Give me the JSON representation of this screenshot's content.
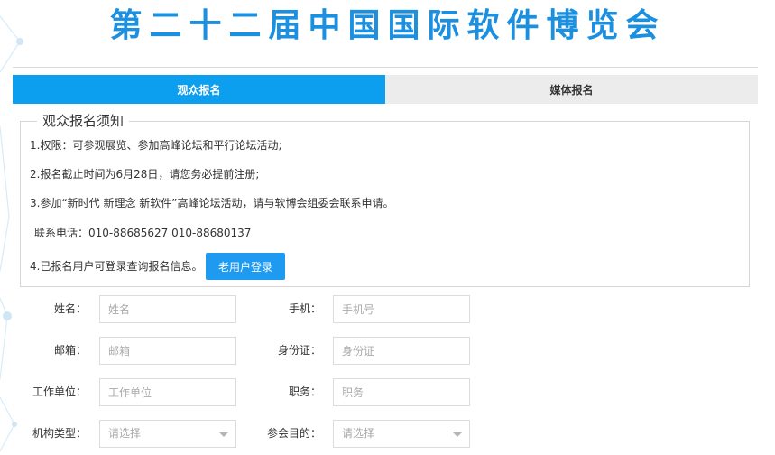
{
  "header": {
    "title": "第二十二届中国国际软件博览会"
  },
  "tabs": [
    {
      "label": "观众报名",
      "active": true
    },
    {
      "label": "媒体报名",
      "active": false
    }
  ],
  "notice": {
    "title": "观众报名须知",
    "line1": "1.权限：可参观展览、参加高峰论坛和平行论坛活动;",
    "line2": "2.报名截止时间为6月28日，请您务必提前注册;",
    "line3": "3.参加“新时代 新理念 新软件”高峰论坛活动，请与软博会组委会联系申请。",
    "phone": "联系电话：010-88685627   010-88680137",
    "line4": "4.已报名用户可登录查询报名信息。",
    "login_button": "老用户登录"
  },
  "form": {
    "name": {
      "label": "姓名：",
      "placeholder": "姓名"
    },
    "phone": {
      "label": "手机：",
      "placeholder": "手机号"
    },
    "email": {
      "label": "邮箱：",
      "placeholder": "邮箱"
    },
    "id_card": {
      "label": "身份证：",
      "placeholder": "身份证"
    },
    "company": {
      "label": "工作单位：",
      "placeholder": "工作单位"
    },
    "position": {
      "label": "职务：",
      "placeholder": "职务"
    },
    "org_type": {
      "label": "机构类型：",
      "value": "请选择"
    },
    "purpose": {
      "label": "参会目的：",
      "value": "请选择"
    }
  },
  "colors": {
    "accent": "#0c9eef",
    "title": "#1b8fe0",
    "button": "#1e9af0"
  }
}
